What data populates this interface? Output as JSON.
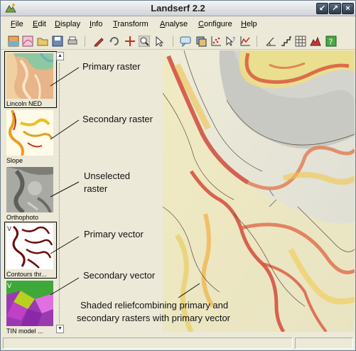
{
  "window": {
    "title": "Landserf 2.2"
  },
  "menu": [
    {
      "label": "File",
      "u": "F",
      "rest": "ile"
    },
    {
      "label": "Edit",
      "u": "E",
      "rest": "dit"
    },
    {
      "label": "Display",
      "u": "D",
      "rest": "isplay"
    },
    {
      "label": "Info",
      "u": "I",
      "rest": "nfo"
    },
    {
      "label": "Transform",
      "u": "T",
      "rest": "ransform"
    },
    {
      "label": "Analyse",
      "u": "A",
      "rest": "nalyse"
    },
    {
      "label": "Configure",
      "u": "C",
      "rest": "onfigure"
    },
    {
      "label": "Help",
      "u": "H",
      "rest": "elp"
    }
  ],
  "toolbar": {
    "icons": [
      "raster-icon",
      "vector-icon",
      "open-icon",
      "save-icon",
      "print-icon",
      "edit-pencil-icon",
      "rotate-icon",
      "cross-tool-icon",
      "zoom-icon",
      "arrow-cursor-icon",
      "comment-icon",
      "layers-icon",
      "scatter-plot-icon",
      "query-icon",
      "line-graph-icon",
      "angle-icon",
      "steps-icon",
      "grid-icon",
      "terrain-icon",
      "help-icon"
    ]
  },
  "thumbnails": [
    {
      "label": "Lincoln NED",
      "name": "thumb-lincoln-ned",
      "selected": true
    },
    {
      "label": "Slope",
      "name": "thumb-slope",
      "selected": false
    },
    {
      "label": "Orthophoto",
      "name": "thumb-orthophoto",
      "selected": false
    },
    {
      "label": "Contours thr...",
      "name": "thumb-contours",
      "selected": true
    },
    {
      "label": "TIN model ...",
      "name": "thumb-tin-model",
      "selected": false
    }
  ],
  "annotations": {
    "primary_raster": "Primary raster",
    "secondary_raster": "Secondary raster",
    "unselected_1": "Unselected",
    "unselected_2": "raster",
    "primary_vector": "Primary vector",
    "secondary_vector": "Secondary vector",
    "shaded_1": "Shaded reliefcombining primary and",
    "shaded_2": "secondary rasters with primary vector"
  },
  "colors": {
    "relief_red": "#c8383b",
    "relief_yellow": "#e8d54a",
    "relief_bg": "#d9d9d2"
  }
}
